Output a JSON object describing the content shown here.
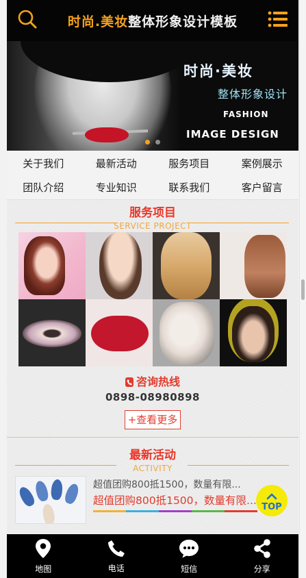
{
  "header": {
    "title_accent": "时尚.美妆",
    "title_rest": "整体形象设计模板",
    "search_icon": "search-icon",
    "menu_icon": "menu-icon"
  },
  "banner": {
    "line1": "时尚·美妆",
    "line2": "整体形象设计",
    "line3": "FASHION",
    "line4": "IMAGE DESIGN",
    "slide_count": 2,
    "active_slide": 1
  },
  "nav": {
    "items": [
      {
        "label": "关于我们"
      },
      {
        "label": "最新活动"
      },
      {
        "label": "服务项目"
      },
      {
        "label": "案例展示"
      },
      {
        "label": "团队介绍"
      },
      {
        "label": "专业知识"
      },
      {
        "label": "联系我们"
      },
      {
        "label": "客户留言"
      }
    ]
  },
  "services": {
    "title": "服务项目",
    "subtitle": "SERVICE PROJECT",
    "hotline_label": "咨询热线",
    "hotline_number": "0898-08980898",
    "more_label": "+查看更多"
  },
  "activity": {
    "title": "最新活动",
    "subtitle": "ACTIVITY",
    "items": [
      {
        "title": "超值团购800抵1500，数量有限...",
        "subtitle": "超值团购800抵1500，数量有限..."
      }
    ]
  },
  "top_button": {
    "label": "TOP"
  },
  "footer": {
    "items": [
      {
        "label": "地图",
        "icon": "map-pin-icon"
      },
      {
        "label": "电话",
        "icon": "phone-icon"
      },
      {
        "label": "短信",
        "icon": "message-icon"
      },
      {
        "label": "分享",
        "icon": "share-icon"
      }
    ]
  },
  "colors": {
    "accent": "#f6a21d",
    "red": "#e23b2d",
    "header_bg": "#050505",
    "top_button": "#f5ea0a"
  }
}
